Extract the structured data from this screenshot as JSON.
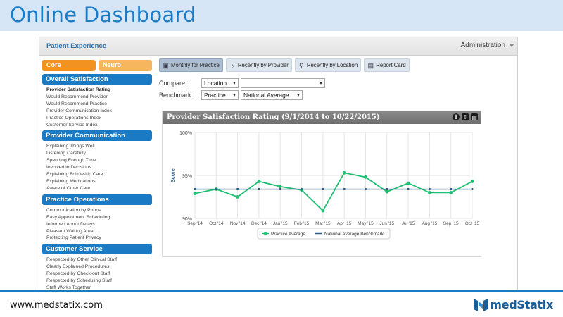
{
  "slide": {
    "title": "Online Dashboard",
    "footer_url": "www.medstatix.com",
    "logo_text": "medStatix"
  },
  "app": {
    "title": "Patient Experience",
    "admin_label": "Administration"
  },
  "categories": [
    {
      "label": "Core",
      "color": "#f29220"
    },
    {
      "label": "Neuro",
      "color": "#f6b65e"
    }
  ],
  "sections": [
    {
      "title": "Overall Satisfaction",
      "items": [
        "Provider Satisfaction Rating",
        "Would Recommend Provider",
        "Would Recommend Practice",
        "Provider Communication Index",
        "Practice Operations Index",
        "Customer Service Index"
      ]
    },
    {
      "title": "Provider Communication",
      "items": [
        "Explaining Things Well",
        "Listening Carefully",
        "Spending Enough Time",
        "Involved in Decisions",
        "Explaining Follow-Up Care",
        "Explaining Medications",
        "Aware of Other Care"
      ]
    },
    {
      "title": "Practice Operations",
      "items": [
        "Communication by Phone",
        "Easy Appointment Scheduling",
        "Informed About Delays",
        "Pleasant Waiting Area",
        "Protecting Patient Privacy"
      ]
    },
    {
      "title": "Customer Service",
      "items": [
        "Respected by Other Clinical Staff",
        "Clearly Explained Procedures",
        "Respected by Check-out Staff",
        "Respected by Scheduling Staff",
        "Staff Works Together"
      ]
    }
  ],
  "toolbar": [
    {
      "label": "Monthly for Practice",
      "icon": "calendar-icon",
      "glyph": "▣",
      "active": true
    },
    {
      "label": "Recently by Provider",
      "icon": "stethoscope-icon",
      "glyph": "♁",
      "active": false
    },
    {
      "label": "Recently by Location",
      "icon": "location-pin-icon",
      "glyph": "⚲",
      "active": false
    },
    {
      "label": "Report Card",
      "icon": "report-card-icon",
      "glyph": "▤",
      "active": false
    }
  ],
  "compare": {
    "label": "Compare:",
    "select1": "Location",
    "select2": ""
  },
  "benchmark": {
    "label": "Benchmark:",
    "select1": "Practice",
    "select2": "National Average"
  },
  "chart_panel": {
    "title": "Provider Satisfaction Rating (9/1/2014 to 10/22/2015)",
    "icons": [
      "info-icon",
      "export-icon",
      "print-icon"
    ]
  },
  "chart_data": {
    "type": "line",
    "categories": [
      "Sep '14",
      "Oct '14",
      "Nov '14",
      "Dec '14",
      "Jan '15",
      "Feb '15",
      "Mar '15",
      "Apr '15",
      "May '15",
      "Jun '15",
      "Jul '15",
      "Aug '15",
      "Sep '15",
      "Oct '15"
    ],
    "series": [
      {
        "name": "Practice Average",
        "color": "#1fbf72",
        "values": [
          92.9,
          93.4,
          92.5,
          94.3,
          93.7,
          93.3,
          90.9,
          95.3,
          94.8,
          93.1,
          94.1,
          93.0,
          93.0,
          94.3
        ]
      },
      {
        "name": "National Average Benchmark",
        "color": "#2b5d8a",
        "values": [
          93.4,
          93.4,
          93.4,
          93.4,
          93.4,
          93.4,
          93.4,
          93.4,
          93.4,
          93.4,
          93.4,
          93.4,
          93.4,
          93.4
        ]
      }
    ],
    "ylabel": "Score",
    "ylim": [
      90,
      100
    ],
    "yticks": [
      "90%",
      "95%",
      "100%"
    ],
    "grid": true,
    "legend": "bottom"
  }
}
